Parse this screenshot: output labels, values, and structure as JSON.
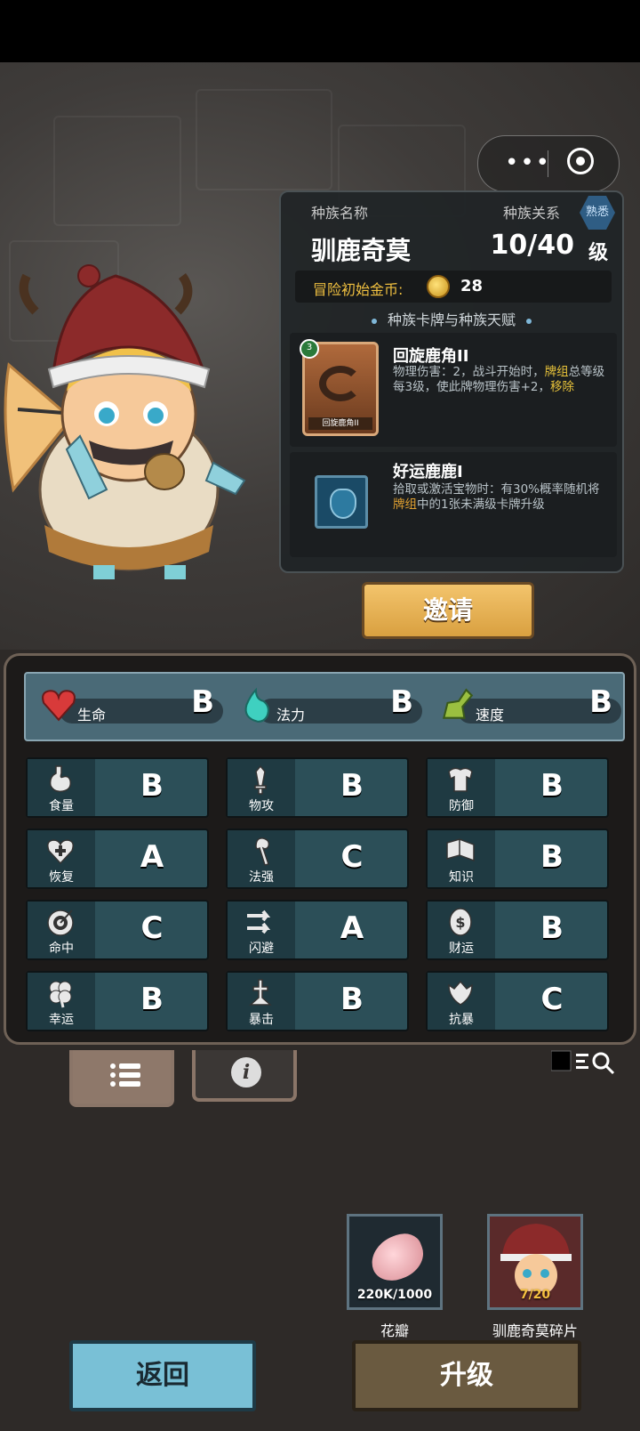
{
  "race": {
    "name_label": "种族名称",
    "name": "驯鹿奇莫",
    "relation_label": "种族关系",
    "relation_badge": "熟悉",
    "level": "10/40",
    "level_unit": "级",
    "gold_label": "冒险初始金币:",
    "gold_value": "28",
    "section_title": "种族卡牌与种族天赋"
  },
  "card": {
    "level_badge": "3",
    "art_caption": "回旋鹿角II",
    "title": "回旋鹿角II",
    "desc_1": "物理伤害：2，战斗开始时，",
    "desc_hl_1": "牌组",
    "desc_2": "总等级每3级，使此牌物理伤害+2，",
    "desc_hl_2": "移除"
  },
  "talent": {
    "title": "好运鹿鹿I",
    "desc_1": "拾取或激活宝物时：有30%概率随机将",
    "desc_hl": "牌组",
    "desc_2": "中的1张未满级卡牌升级"
  },
  "invite_label": "邀请",
  "top_stats": [
    {
      "name": "生命",
      "grade": "B",
      "icon": "heart-icon",
      "color": "#d83a3a"
    },
    {
      "name": "法力",
      "grade": "B",
      "icon": "mana-flame-icon",
      "color": "#3fd0c0"
    },
    {
      "name": "速度",
      "grade": "B",
      "icon": "wing-boot-icon",
      "color": "#9abf40"
    }
  ],
  "stats": [
    {
      "name": "食量",
      "grade": "B",
      "icon": "stomach-icon"
    },
    {
      "name": "物攻",
      "grade": "B",
      "icon": "sword-icon"
    },
    {
      "name": "防御",
      "grade": "B",
      "icon": "armor-icon"
    },
    {
      "name": "恢复",
      "grade": "A",
      "icon": "heart-plus-icon"
    },
    {
      "name": "法强",
      "grade": "C",
      "icon": "staff-icon"
    },
    {
      "name": "知识",
      "grade": "B",
      "icon": "book-icon"
    },
    {
      "name": "命中",
      "grade": "C",
      "icon": "target-icon"
    },
    {
      "name": "闪避",
      "grade": "A",
      "icon": "dodge-arrows-icon"
    },
    {
      "name": "财运",
      "grade": "B",
      "icon": "coin-dollar-icon"
    },
    {
      "name": "幸运",
      "grade": "B",
      "icon": "clover-icon"
    },
    {
      "name": "暴击",
      "grade": "B",
      "icon": "crit-burst-icon"
    },
    {
      "name": "抗暴",
      "grade": "C",
      "icon": "crit-shield-icon"
    }
  ],
  "resources": [
    {
      "count": "220K/1000",
      "label": "花瓣",
      "icon": "petal-icon"
    },
    {
      "count": "7/20",
      "label": "驯鹿奇莫碎片",
      "icon": "character-shard-icon"
    }
  ],
  "buttons": {
    "back": "返回",
    "upgrade": "升级"
  }
}
